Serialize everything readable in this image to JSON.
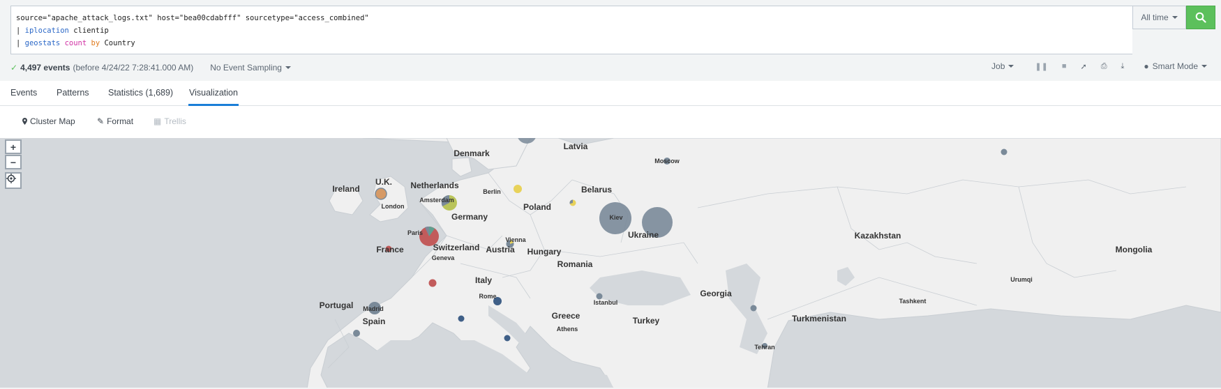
{
  "search": {
    "line1": "source=\"apache_attack_logs.txt\" host=\"bea00cdabfff\" sourcetype=\"access_combined\"",
    "line2_pipe": "| ",
    "line2_cmd": "iplocation",
    "line2_arg": " clientip",
    "line3_pipe": "| ",
    "line3_cmd": "geostats",
    "line3_fn": "count",
    "line3_by": "by",
    "line3_field": "Country",
    "time_range": "All time"
  },
  "status": {
    "event_count": "4,497 events",
    "before_text": "(before 4/24/22 7:28:41.000 AM)",
    "sampling": "No Event Sampling",
    "job": "Job",
    "mode": "Smart Mode"
  },
  "tabs": [
    {
      "label": "Events"
    },
    {
      "label": "Patterns"
    },
    {
      "label": "Statistics (1,689)"
    },
    {
      "label": "Visualization"
    }
  ],
  "active_tab": "Visualization",
  "viz_toolbar": {
    "viz_type": "Cluster Map",
    "format": "Format",
    "trellis": "Trellis"
  },
  "map": {
    "countries": [
      "Denmark",
      "Latvia",
      "Ireland",
      "U.K.",
      "Netherlands",
      "Belarus",
      "Poland",
      "Germany",
      "Ukraine",
      "Kazakhstan",
      "France",
      "Switzerland",
      "Austria",
      "Hungary",
      "Mongolia",
      "Romania",
      "Italy",
      "Georgia",
      "Portugal",
      "Spain",
      "Greece",
      "Turkey",
      "Turkmenistan"
    ],
    "cities": [
      "Moscow",
      "Berlin",
      "London",
      "Amsterdam",
      "Kiev",
      "Paris",
      "Vienna",
      "Geneva",
      "Urumqi",
      "Rome",
      "Istanbul",
      "Tashkent",
      "Madrid",
      "Athens",
      "Tehran"
    ],
    "zoom_in": "+",
    "zoom_out": "−",
    "colors": {
      "water": "#d4d8dc",
      "land": "#f0f0f0",
      "cluster_gray": "#7a8a99",
      "cluster_red": "#c25b5b",
      "cluster_yellow": "#e8d25a",
      "cluster_olive": "#b9c45a",
      "cluster_blue": "#3f5f87",
      "cluster_orange": "#d69a66"
    }
  }
}
